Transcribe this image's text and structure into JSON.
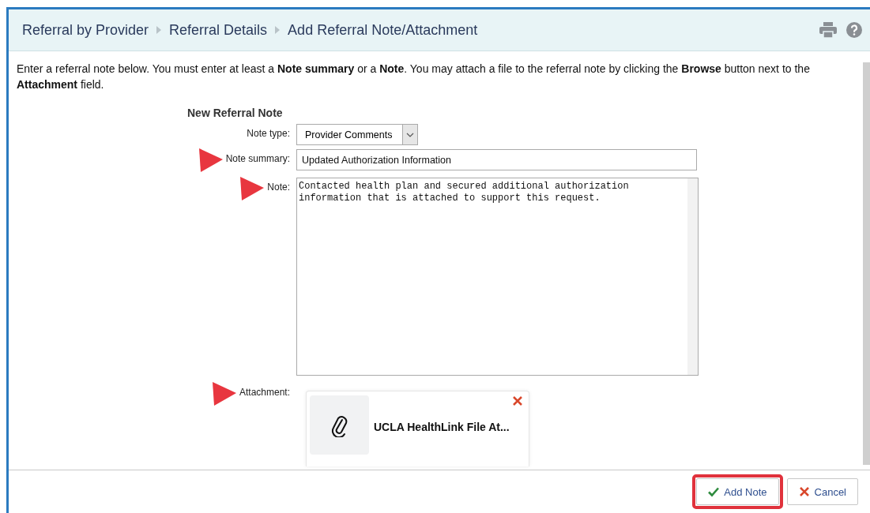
{
  "breadcrumb": [
    {
      "label": "Referral by Provider"
    },
    {
      "label": "Referral Details"
    },
    {
      "label": "Add Referral Note/Attachment"
    }
  ],
  "instructions": "Enter a referral note below. You must enter at least a **Note summary** or a **Note**. You may attach a file to the referral note by clicking the **Browse** button next to the **Attachment** field.",
  "form": {
    "title": "New Referral Note",
    "fields": [
      {
        "kind": "select",
        "label": "Note type:",
        "value": "Provider Comments",
        "annotated": false
      },
      {
        "kind": "text",
        "label": "Note summary:",
        "value": "Updated Authorization Information",
        "annotated": true
      },
      {
        "kind": "textarea",
        "label": "Note:",
        "value": "Contacted health plan and secured additional authorization information that is attached to support this request.",
        "annotated": true
      },
      {
        "kind": "attachment",
        "label": "Attachment:",
        "file_name": "UCLA HealthLink File At...",
        "annotated": true
      }
    ]
  },
  "buttons": [
    {
      "kind": "confirm",
      "label": "Add Note",
      "highlighted": true
    },
    {
      "kind": "cancel",
      "label": "Cancel",
      "highlighted": false
    }
  ]
}
